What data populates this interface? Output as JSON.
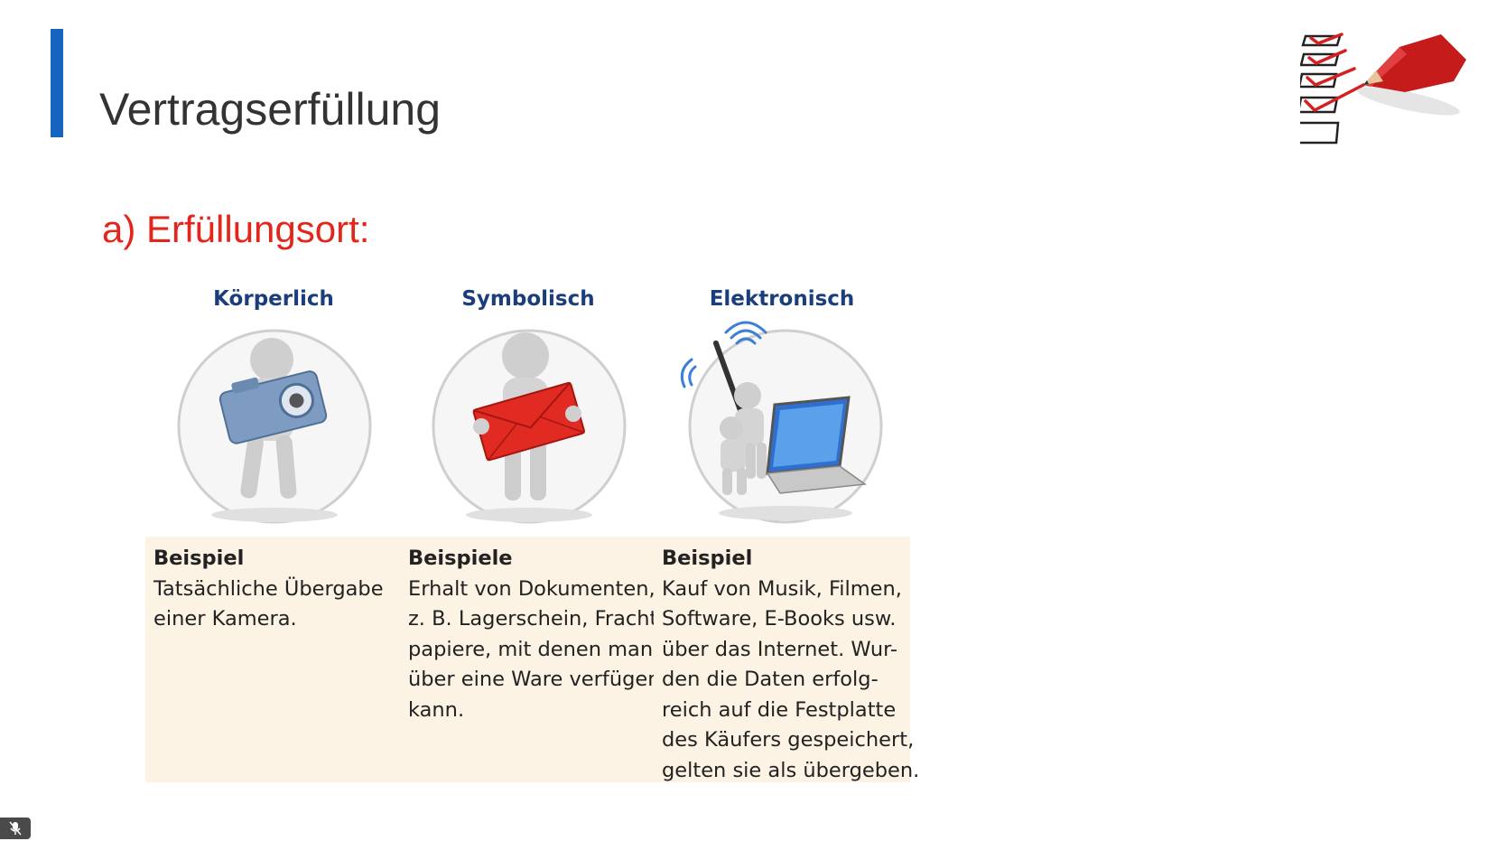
{
  "slide": {
    "title": "Vertragserfüllung",
    "subtitle": "a) Erfüllungsort:"
  },
  "columns": [
    {
      "title": "Körperlich",
      "icon": "person-with-camera",
      "heading": "Beispiel",
      "lines": [
        "Tatsächliche Übergabe",
        "einer Kamera."
      ]
    },
    {
      "title": "Symbolisch",
      "icon": "person-with-envelope",
      "heading": "Beispiele",
      "lines": [
        "Erhalt von Dokumenten,",
        "z. B. Lagerschein, Fracht-",
        "papiere, mit denen man",
        "über eine Ware verfügen",
        "kann."
      ]
    },
    {
      "title": "Elektronisch",
      "icon": "person-with-antenna-and-laptop",
      "heading": "Beispiel",
      "lines": [
        "Kauf von Musik, Filmen,",
        "Software, E-Books usw.",
        "über das Internet. Wur-",
        "den die Daten erfolg-",
        "reich auf die Festplatte",
        "des Käufers gespeichert,",
        "gelten sie als übergeben."
      ]
    }
  ],
  "logo": {
    "icon": "checklist-pencil-icon"
  },
  "mic_badge": {
    "icon": "microphone-muted-icon"
  },
  "colors": {
    "accent_bar": "#1565c0",
    "subtitle": "#e3261b",
    "column_title": "#1a3d7c",
    "text_box_bg": "#fdf3e4"
  }
}
